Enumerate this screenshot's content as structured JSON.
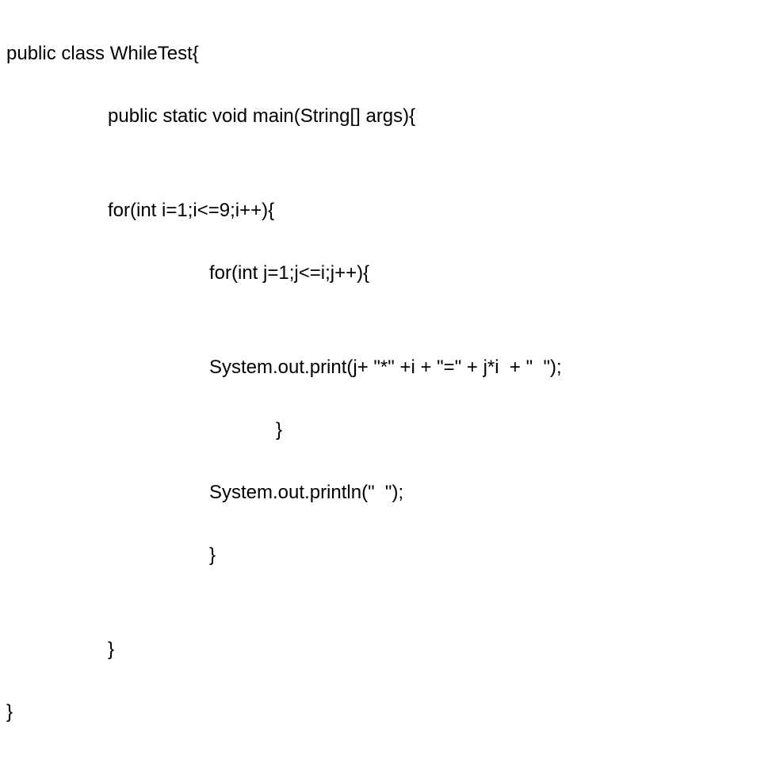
{
  "code": {
    "l1": "public class WhileTest{",
    "l2": "public static void main(String[] args){",
    "l3": "",
    "l4": "for(int i=1;i<=9;i++){",
    "l5": "for(int j=1;j<=i;j++){",
    "l6": "",
    "l7": "System.out.print(j+ \"*\" +i + \"=\" + j*i  + \"  \");",
    "l8": "}",
    "l9": "System.out.println(\"  \");",
    "l10": "}",
    "l11": "",
    "l12": "}",
    "l13": "}"
  }
}
